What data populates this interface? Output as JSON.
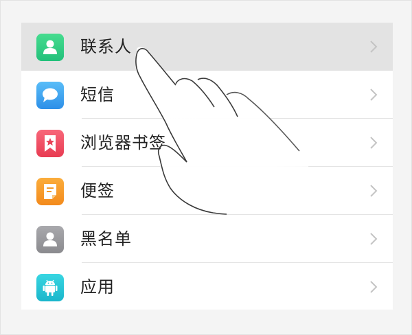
{
  "menu": {
    "items": [
      {
        "label": "联系人",
        "icon": "contacts-icon",
        "color": "#2fcf86",
        "active": true
      },
      {
        "label": "短信",
        "icon": "message-bubble-icon",
        "color": "#3aa3f0",
        "active": false
      },
      {
        "label": "浏览器书签",
        "icon": "bookmark-star-icon",
        "color": "#ef4d62",
        "active": false
      },
      {
        "label": "便签",
        "icon": "note-icon",
        "color": "#f79a26",
        "active": false
      },
      {
        "label": "黑名单",
        "icon": "blacklist-person-icon",
        "color": "#9a9a9e",
        "active": false
      },
      {
        "label": "应用",
        "icon": "android-app-icon",
        "color": "#26c7d8",
        "active": false
      }
    ]
  },
  "overlay": {
    "icon": "pointing-hand-icon"
  }
}
